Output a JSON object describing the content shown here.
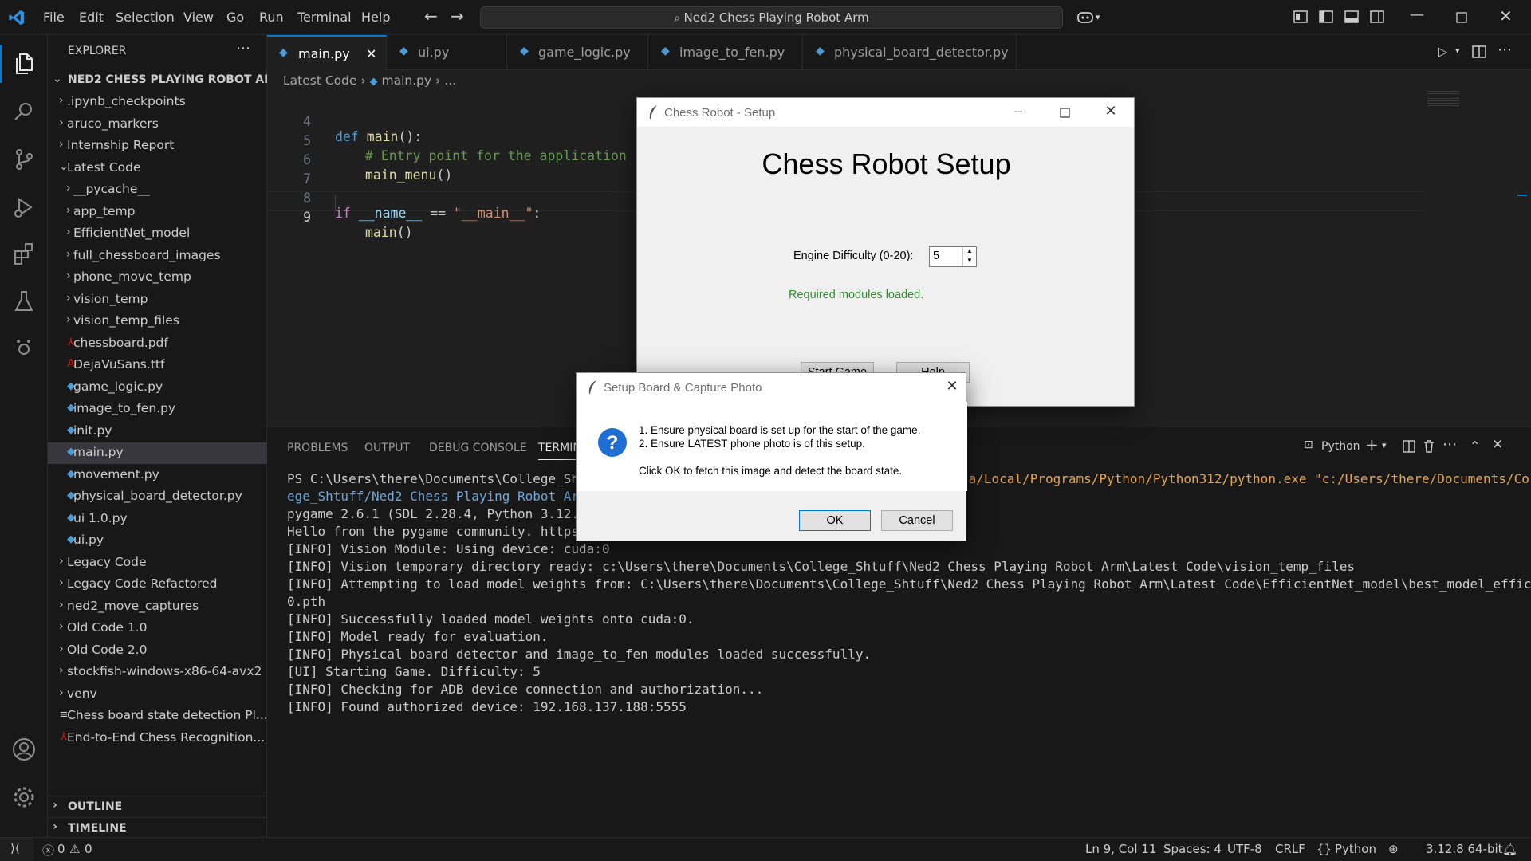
{
  "menu": [
    "File",
    "Edit",
    "Selection",
    "View",
    "Go",
    "Run",
    "Terminal",
    "Help"
  ],
  "search": {
    "text": "Ned2 Chess Playing Robot Arm"
  },
  "explorer": {
    "title": "EXPLORER",
    "root": "NED2 CHESS PLAYING ROBOT ARM",
    "items": [
      {
        "label": ".ipynb_checkpoints",
        "type": "folder",
        "depth": 1,
        "expanded": false
      },
      {
        "label": "aruco_markers",
        "type": "folder",
        "depth": 1,
        "expanded": false
      },
      {
        "label": "Internship Report",
        "type": "folder",
        "depth": 1,
        "expanded": false
      },
      {
        "label": "Latest Code",
        "type": "folder",
        "depth": 1,
        "expanded": true
      },
      {
        "label": "__pycache__",
        "type": "folder",
        "depth": 2,
        "expanded": false
      },
      {
        "label": "app_temp",
        "type": "folder",
        "depth": 2,
        "expanded": false
      },
      {
        "label": "EfficientNet_model",
        "type": "folder",
        "depth": 2,
        "expanded": false
      },
      {
        "label": "full_chessboard_images",
        "type": "folder",
        "depth": 2,
        "expanded": false
      },
      {
        "label": "phone_move_temp",
        "type": "folder",
        "depth": 2,
        "expanded": false
      },
      {
        "label": "vision_temp",
        "type": "folder",
        "depth": 2,
        "expanded": false
      },
      {
        "label": "vision_temp_files",
        "type": "folder",
        "depth": 2,
        "expanded": false
      },
      {
        "label": "chessboard.pdf",
        "type": "pdf",
        "depth": 2
      },
      {
        "label": "DejaVuSans.ttf",
        "type": "font",
        "depth": 2
      },
      {
        "label": "game_logic.py",
        "type": "py",
        "depth": 2
      },
      {
        "label": "image_to_fen.py",
        "type": "py",
        "depth": 2
      },
      {
        "label": "init.py",
        "type": "py",
        "depth": 2
      },
      {
        "label": "main.py",
        "type": "py",
        "depth": 2,
        "selected": true
      },
      {
        "label": "movement.py",
        "type": "py",
        "depth": 2
      },
      {
        "label": "physical_board_detector.py",
        "type": "py",
        "depth": 2
      },
      {
        "label": "ui 1.0.py",
        "type": "py",
        "depth": 2
      },
      {
        "label": "ui.py",
        "type": "py",
        "depth": 2
      },
      {
        "label": "Legacy Code",
        "type": "folder",
        "depth": 1,
        "expanded": false
      },
      {
        "label": "Legacy Code Refactored",
        "type": "folder",
        "depth": 1,
        "expanded": false
      },
      {
        "label": "ned2_move_captures",
        "type": "folder",
        "depth": 1,
        "expanded": false
      },
      {
        "label": "Old Code 1.0",
        "type": "folder",
        "depth": 1,
        "expanded": false
      },
      {
        "label": "Old Code 2.0",
        "type": "folder",
        "depth": 1,
        "expanded": false
      },
      {
        "label": "stockfish-windows-x86-64-avx2",
        "type": "folder",
        "depth": 1,
        "expanded": false
      },
      {
        "label": "venv",
        "type": "folder",
        "depth": 1,
        "expanded": false
      },
      {
        "label": "Chess board state detection Pl...",
        "type": "doc",
        "depth": 1
      },
      {
        "label": "End-to-End Chess Recognition...",
        "type": "pdf",
        "depth": 1
      }
    ],
    "outline": "OUTLINE",
    "timeline": "TIMELINE"
  },
  "tabs": [
    {
      "label": "main.py",
      "active": true
    },
    {
      "label": "ui.py"
    },
    {
      "label": "game_logic.py"
    },
    {
      "label": "image_to_fen.py"
    },
    {
      "label": "physical_board_detector.py"
    }
  ],
  "breadcrumb": {
    "folder": "Latest Code",
    "file": "main.py",
    "rest": "..."
  },
  "code": {
    "l4": {
      "n": "4",
      "kw": "def",
      "fn": "main",
      "rest": "():"
    },
    "l5": {
      "n": "5",
      "comment": "# Entry point for the application"
    },
    "l6": {
      "n": "6",
      "fn": "main_menu",
      "rest": "()"
    },
    "l7": {
      "n": "7"
    },
    "l8": {
      "n": "8",
      "kw": "if",
      "var": "__name__",
      "op": " == ",
      "str": "\"__main__\"",
      "rest": ":"
    },
    "l9": {
      "n": "9",
      "fn": "main",
      "rest": "()"
    }
  },
  "panel": {
    "tabs": [
      "PROBLEMS",
      "OUTPUT",
      "DEBUG CONSOLE",
      "TERMINAL"
    ],
    "shell": "Python",
    "terminal": {
      "l1a": "PS C:\\Users\\there\\Documents\\College_Shtuf",
      "l1b": "ta/Local/Programs/Python/Python312/python.exe \"c:/Users/there/Documents/Coll",
      "l2": "ege_Shtuff/Ned2 Chess Playing Robot Arm/",
      "l3": "pygame 2.6.1 (SDL 2.28.4, Python 3.12.8)",
      "l4": "Hello from the pygame community. https:/",
      "l5": "[INFO] Vision Module: Using device: cuda:0",
      "l6": "[INFO] Vision temporary directory ready: c:\\Users\\there\\Documents\\College_Shtuff\\Ned2 Chess Playing Robot Arm\\Latest Code\\vision_temp_files",
      "l7": "[INFO] Attempting to load model weights from: C:\\Users\\there\\Documents\\College_Shtuff\\Ned2 Chess Playing Robot Arm\\Latest Code\\EfficientNet_model\\best_model_efficientnet_b",
      "l8": "0.pth",
      "l9": "[INFO] Successfully loaded model weights onto cuda:0.",
      "l10": "[INFO] Model ready for evaluation.",
      "l11": "[INFO] Physical board detector and image_to_fen modules loaded successfully.",
      "l12": "[UI] Starting Game. Difficulty: 5",
      "l13": "[INFO] Checking for ADB device connection and authorization...",
      "l14": "[INFO] Found authorized device: 192.168.137.188:5555"
    }
  },
  "status": {
    "errors": "0",
    "warnings": "0",
    "position": "Ln 9, Col 11",
    "spaces": "Spaces: 4",
    "encoding": "UTF-8",
    "eol": "CRLF",
    "language": "Python",
    "interpreter": "3.12.8 64-bit"
  },
  "setup_window": {
    "title": "Chess Robot - Setup",
    "heading": "Chess Robot Setup",
    "difficulty_label": "Engine Difficulty (0-20):",
    "difficulty_value": "5",
    "status": "Required modules loaded.",
    "status_color": "#2e8b2e",
    "start_button": "Start Game",
    "help_button": "Help"
  },
  "capture_dialog": {
    "title": "Setup Board & Capture Photo",
    "line1": "1. Ensure physical board is set up for the start of the game.",
    "line2": "2. Ensure LATEST phone photo is of this setup.",
    "line3": "Click OK to fetch this image and detect the board state.",
    "ok": "OK",
    "cancel": "Cancel"
  },
  "colors": {
    "accent": "#0078d4",
    "python_icon": "#4d9bd6",
    "pdf_icon": "#e51400"
  }
}
